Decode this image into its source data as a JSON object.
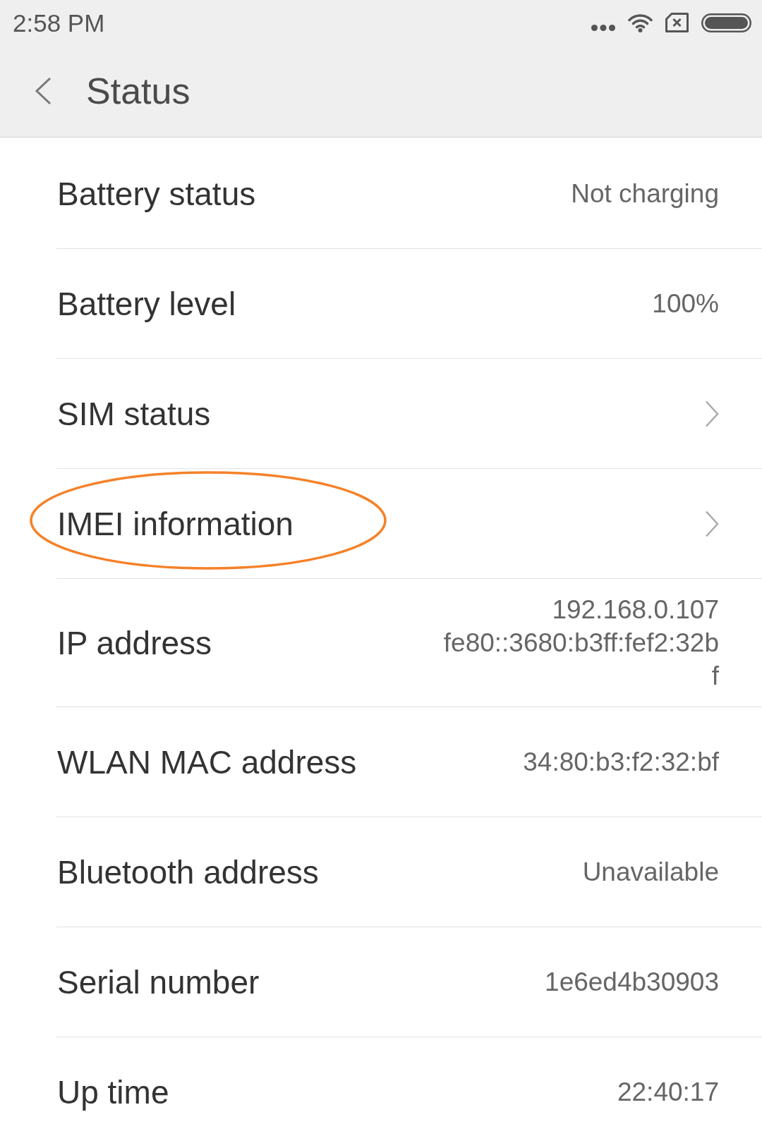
{
  "status_bar": {
    "time": "2:58 PM"
  },
  "toolbar": {
    "title": "Status"
  },
  "rows": [
    {
      "kind": "value",
      "label": "Battery status",
      "value": "Not charging",
      "highlighted": false
    },
    {
      "kind": "value",
      "label": "Battery level",
      "value": "100%",
      "highlighted": false
    },
    {
      "kind": "link",
      "label": "SIM status",
      "highlighted": false
    },
    {
      "kind": "link",
      "label": "IMEI information",
      "highlighted": true
    },
    {
      "kind": "multiline",
      "label": "IP address",
      "value_lines": [
        "192.168.0.107",
        "fe80::3680:b3ff:fef2:32b",
        "f"
      ],
      "highlighted": false
    },
    {
      "kind": "value",
      "label": "WLAN MAC address",
      "value": "34:80:b3:f2:32:bf",
      "highlighted": false
    },
    {
      "kind": "value",
      "label": "Bluetooth address",
      "value": "Unavailable",
      "highlighted": false
    },
    {
      "kind": "value",
      "label": "Serial number",
      "value": "1e6ed4b30903",
      "highlighted": false
    },
    {
      "kind": "value",
      "label": "Up time",
      "value": "22:40:17",
      "highlighted": false
    }
  ]
}
